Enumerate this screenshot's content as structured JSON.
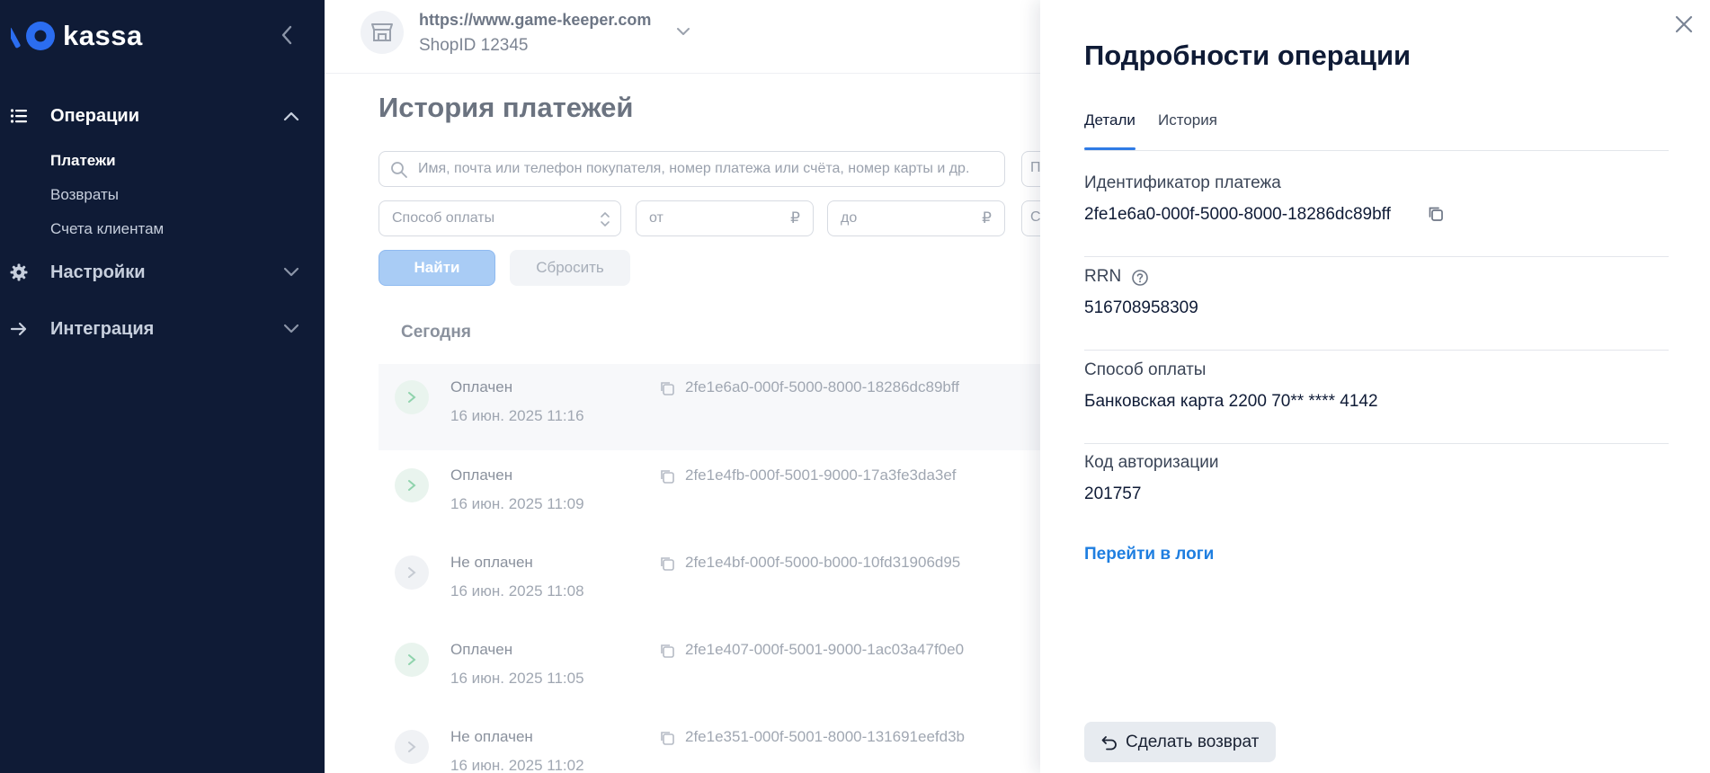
{
  "sidebar": {
    "brand": "kassa",
    "sections": [
      {
        "label": "Операции",
        "expanded": true,
        "items": [
          "Платежи",
          "Возвраты",
          "Счета клиентам"
        ],
        "active_item": "Платежи"
      },
      {
        "label": "Настройки",
        "expanded": false
      },
      {
        "label": "Интеграция",
        "expanded": false
      }
    ]
  },
  "topbar": {
    "shop_url": "https://www.game-keeper.com",
    "shop_id": "ShopID 12345"
  },
  "main": {
    "title": "История платежей",
    "search_placeholder": "Имя, почта или телефон покупателя, номер платежа или счёта, номер карты и др.",
    "right_field_glyph": "П",
    "right_field_glyph2": "С",
    "payment_method_placeholder": "Способ оплаты",
    "amount_from_placeholder": "от",
    "amount_to_placeholder": "до",
    "currency": "₽",
    "find_button": "Найти",
    "reset_button": "Сбросить",
    "day_label": "Сегодня",
    "payments": [
      {
        "status": "Оплачен",
        "date": "16 июн. 2025 11:16",
        "id": "2fe1e6a0-000f-5000-8000-18286dc89bff"
      },
      {
        "status": "Оплачен",
        "date": "16 июн. 2025 11:09",
        "id": "2fe1e4fb-000f-5001-9000-17a3fe3da3ef"
      },
      {
        "status": "Не оплачен",
        "date": "16 июн. 2025 11:08",
        "id": "2fe1e4bf-000f-5000-b000-10fd31906d95"
      },
      {
        "status": "Оплачен",
        "date": "16 июн. 2025 11:05",
        "id": "2fe1e407-000f-5001-9000-1ac03a47f0e0"
      },
      {
        "status": "Не оплачен",
        "date": "16 июн. 2025 11:02",
        "id": "2fe1e351-000f-5001-8000-131691eefd3b"
      }
    ]
  },
  "drawer": {
    "title": "Подробности операции",
    "tabs": [
      "Детали",
      "История"
    ],
    "active_tab": "Детали",
    "fields": [
      {
        "label": "Идентификатор платежа",
        "value": "2fe1e6a0-000f-5000-8000-18286dc89bff"
      },
      {
        "label": "RRN",
        "value": "516708958309"
      },
      {
        "label": "Способ оплаты",
        "value": "Банковская карта 2200 70** **** 4142"
      },
      {
        "label": "Код авторизации",
        "value": "201757"
      }
    ],
    "logs_link": "Перейти в логи",
    "refund_button": "Сделать возврат"
  },
  "colors": {
    "sidebar_bg": "#0f1b36",
    "accent_blue": "#2f7be5",
    "link_blue": "#1e7ee0",
    "logo_blue": "#2b6df0"
  }
}
